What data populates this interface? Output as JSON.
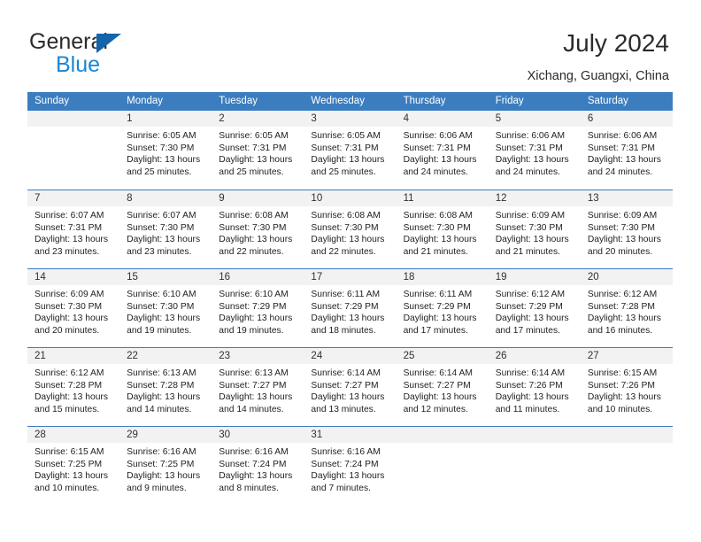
{
  "brand": {
    "name_part1": "General",
    "name_part2": "Blue",
    "triangle_color": "#1464aa",
    "blue_color": "#1b86d4"
  },
  "header": {
    "title": "July 2024",
    "location": "Xichang, Guangxi, China"
  },
  "theme": {
    "header_blue": "#3b7dbf",
    "daynum_band": "#f2f2f2",
    "text": "#1f1f1f"
  },
  "weekdays": [
    "Sunday",
    "Monday",
    "Tuesday",
    "Wednesday",
    "Thursday",
    "Friday",
    "Saturday"
  ],
  "weeks": [
    [
      {
        "day": "",
        "lines": []
      },
      {
        "day": "1",
        "lines": [
          "Sunrise: 6:05 AM",
          "Sunset: 7:30 PM",
          "Daylight: 13 hours",
          "and 25 minutes."
        ]
      },
      {
        "day": "2",
        "lines": [
          "Sunrise: 6:05 AM",
          "Sunset: 7:31 PM",
          "Daylight: 13 hours",
          "and 25 minutes."
        ]
      },
      {
        "day": "3",
        "lines": [
          "Sunrise: 6:05 AM",
          "Sunset: 7:31 PM",
          "Daylight: 13 hours",
          "and 25 minutes."
        ]
      },
      {
        "day": "4",
        "lines": [
          "Sunrise: 6:06 AM",
          "Sunset: 7:31 PM",
          "Daylight: 13 hours",
          "and 24 minutes."
        ]
      },
      {
        "day": "5",
        "lines": [
          "Sunrise: 6:06 AM",
          "Sunset: 7:31 PM",
          "Daylight: 13 hours",
          "and 24 minutes."
        ]
      },
      {
        "day": "6",
        "lines": [
          "Sunrise: 6:06 AM",
          "Sunset: 7:31 PM",
          "Daylight: 13 hours",
          "and 24 minutes."
        ]
      }
    ],
    [
      {
        "day": "7",
        "lines": [
          "Sunrise: 6:07 AM",
          "Sunset: 7:31 PM",
          "Daylight: 13 hours",
          "and 23 minutes."
        ]
      },
      {
        "day": "8",
        "lines": [
          "Sunrise: 6:07 AM",
          "Sunset: 7:30 PM",
          "Daylight: 13 hours",
          "and 23 minutes."
        ]
      },
      {
        "day": "9",
        "lines": [
          "Sunrise: 6:08 AM",
          "Sunset: 7:30 PM",
          "Daylight: 13 hours",
          "and 22 minutes."
        ]
      },
      {
        "day": "10",
        "lines": [
          "Sunrise: 6:08 AM",
          "Sunset: 7:30 PM",
          "Daylight: 13 hours",
          "and 22 minutes."
        ]
      },
      {
        "day": "11",
        "lines": [
          "Sunrise: 6:08 AM",
          "Sunset: 7:30 PM",
          "Daylight: 13 hours",
          "and 21 minutes."
        ]
      },
      {
        "day": "12",
        "lines": [
          "Sunrise: 6:09 AM",
          "Sunset: 7:30 PM",
          "Daylight: 13 hours",
          "and 21 minutes."
        ]
      },
      {
        "day": "13",
        "lines": [
          "Sunrise: 6:09 AM",
          "Sunset: 7:30 PM",
          "Daylight: 13 hours",
          "and 20 minutes."
        ]
      }
    ],
    [
      {
        "day": "14",
        "lines": [
          "Sunrise: 6:09 AM",
          "Sunset: 7:30 PM",
          "Daylight: 13 hours",
          "and 20 minutes."
        ]
      },
      {
        "day": "15",
        "lines": [
          "Sunrise: 6:10 AM",
          "Sunset: 7:30 PM",
          "Daylight: 13 hours",
          "and 19 minutes."
        ]
      },
      {
        "day": "16",
        "lines": [
          "Sunrise: 6:10 AM",
          "Sunset: 7:29 PM",
          "Daylight: 13 hours",
          "and 19 minutes."
        ]
      },
      {
        "day": "17",
        "lines": [
          "Sunrise: 6:11 AM",
          "Sunset: 7:29 PM",
          "Daylight: 13 hours",
          "and 18 minutes."
        ]
      },
      {
        "day": "18",
        "lines": [
          "Sunrise: 6:11 AM",
          "Sunset: 7:29 PM",
          "Daylight: 13 hours",
          "and 17 minutes."
        ]
      },
      {
        "day": "19",
        "lines": [
          "Sunrise: 6:12 AM",
          "Sunset: 7:29 PM",
          "Daylight: 13 hours",
          "and 17 minutes."
        ]
      },
      {
        "day": "20",
        "lines": [
          "Sunrise: 6:12 AM",
          "Sunset: 7:28 PM",
          "Daylight: 13 hours",
          "and 16 minutes."
        ]
      }
    ],
    [
      {
        "day": "21",
        "lines": [
          "Sunrise: 6:12 AM",
          "Sunset: 7:28 PM",
          "Daylight: 13 hours",
          "and 15 minutes."
        ]
      },
      {
        "day": "22",
        "lines": [
          "Sunrise: 6:13 AM",
          "Sunset: 7:28 PM",
          "Daylight: 13 hours",
          "and 14 minutes."
        ]
      },
      {
        "day": "23",
        "lines": [
          "Sunrise: 6:13 AM",
          "Sunset: 7:27 PM",
          "Daylight: 13 hours",
          "and 14 minutes."
        ]
      },
      {
        "day": "24",
        "lines": [
          "Sunrise: 6:14 AM",
          "Sunset: 7:27 PM",
          "Daylight: 13 hours",
          "and 13 minutes."
        ]
      },
      {
        "day": "25",
        "lines": [
          "Sunrise: 6:14 AM",
          "Sunset: 7:27 PM",
          "Daylight: 13 hours",
          "and 12 minutes."
        ]
      },
      {
        "day": "26",
        "lines": [
          "Sunrise: 6:14 AM",
          "Sunset: 7:26 PM",
          "Daylight: 13 hours",
          "and 11 minutes."
        ]
      },
      {
        "day": "27",
        "lines": [
          "Sunrise: 6:15 AM",
          "Sunset: 7:26 PM",
          "Daylight: 13 hours",
          "and 10 minutes."
        ]
      }
    ],
    [
      {
        "day": "28",
        "lines": [
          "Sunrise: 6:15 AM",
          "Sunset: 7:25 PM",
          "Daylight: 13 hours",
          "and 10 minutes."
        ]
      },
      {
        "day": "29",
        "lines": [
          "Sunrise: 6:16 AM",
          "Sunset: 7:25 PM",
          "Daylight: 13 hours",
          "and 9 minutes."
        ]
      },
      {
        "day": "30",
        "lines": [
          "Sunrise: 6:16 AM",
          "Sunset: 7:24 PM",
          "Daylight: 13 hours",
          "and 8 minutes."
        ]
      },
      {
        "day": "31",
        "lines": [
          "Sunrise: 6:16 AM",
          "Sunset: 7:24 PM",
          "Daylight: 13 hours",
          "and 7 minutes."
        ]
      },
      {
        "day": "",
        "lines": []
      },
      {
        "day": "",
        "lines": []
      },
      {
        "day": "",
        "lines": []
      }
    ]
  ]
}
